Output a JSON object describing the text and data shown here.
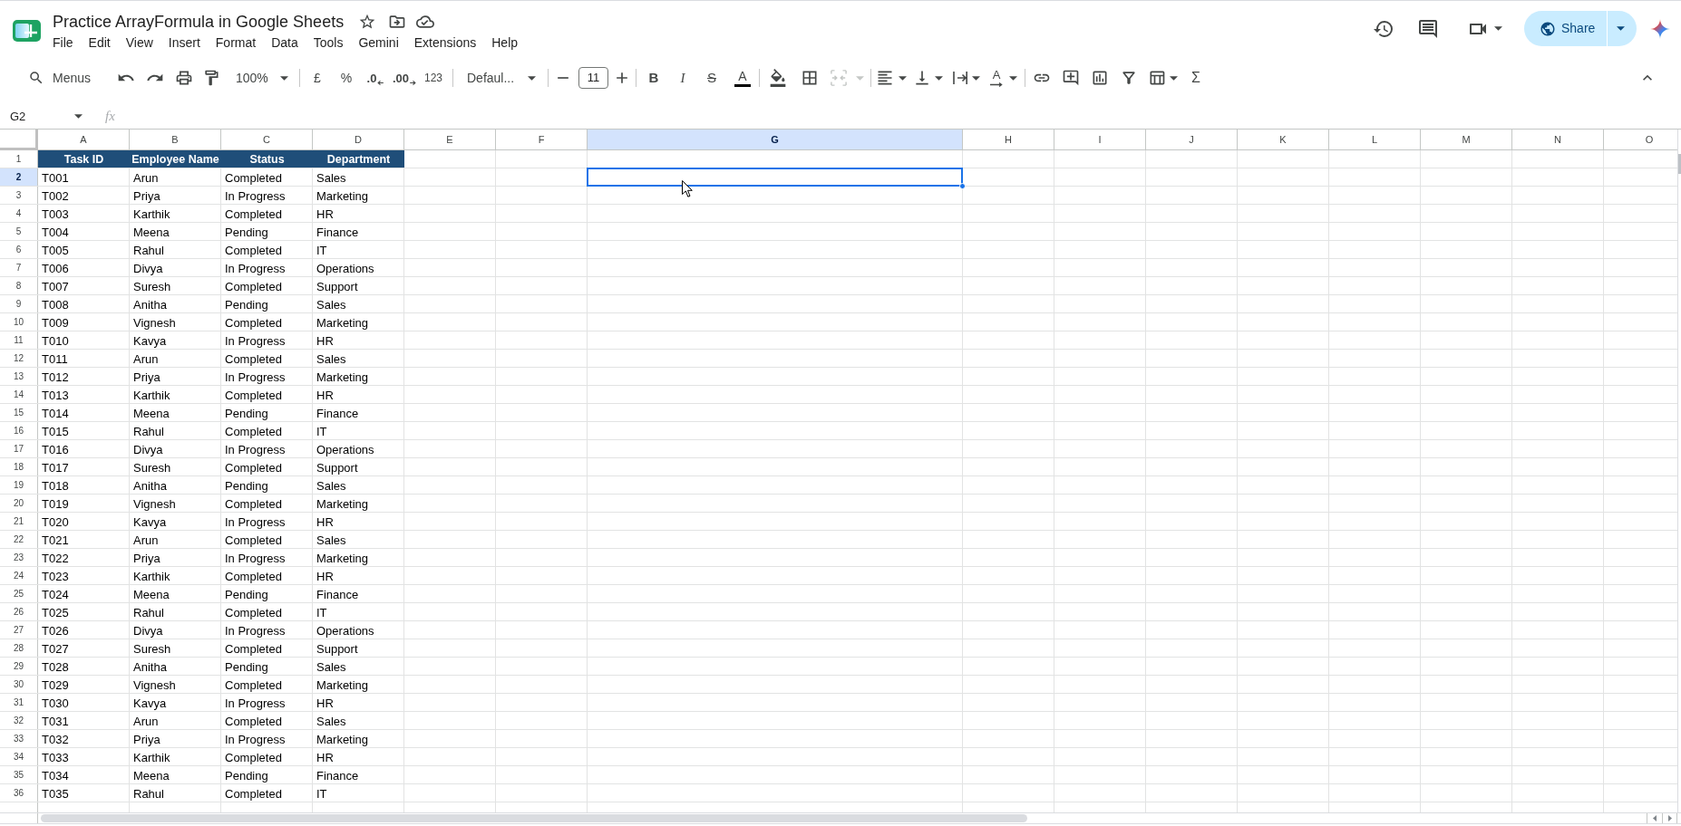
{
  "document": {
    "title": "Practice ArrayFormula in Google Sheets"
  },
  "menu": [
    "File",
    "Edit",
    "View",
    "Insert",
    "Format",
    "Data",
    "Tools",
    "Gemini",
    "Extensions",
    "Help"
  ],
  "share": {
    "label": "Share"
  },
  "toolbar": {
    "search": {
      "placeholder": "Menus"
    },
    "zoom": "100%",
    "currency": "£",
    "percent": "%",
    "decrease_decimals": ".0",
    "increase_decimals": ".00",
    "number_format": "123",
    "font": "Defaul...",
    "font_size": "11",
    "bold": "B",
    "italic": "I",
    "strikethrough": "S",
    "text_color": "A",
    "merge": {
      "disabled": true
    },
    "text_rotation": "A",
    "functions": "Σ"
  },
  "formula_bar": {
    "name_box": "G2",
    "fx": "fx"
  },
  "sheet": {
    "columns": [
      {
        "label": "A",
        "selected": false
      },
      {
        "label": "B",
        "selected": false
      },
      {
        "label": "C",
        "selected": false
      },
      {
        "label": "D",
        "selected": false
      },
      {
        "label": "E",
        "selected": false
      },
      {
        "label": "F",
        "selected": false
      },
      {
        "label": "G",
        "selected": true
      },
      {
        "label": "H",
        "selected": false
      },
      {
        "label": "I",
        "selected": false
      },
      {
        "label": "J",
        "selected": false
      },
      {
        "label": "K",
        "selected": false
      },
      {
        "label": "L",
        "selected": false
      },
      {
        "label": "M",
        "selected": false
      },
      {
        "label": "N",
        "selected": false
      },
      {
        "label": "O",
        "selected": false
      }
    ],
    "header_row": {
      "number": "1",
      "selected": false,
      "cells": [
        "Task ID",
        "Employee Name",
        "Status",
        "Department"
      ]
    },
    "rows": [
      {
        "number": "2",
        "selected": true,
        "cells": [
          "T001",
          "Arun",
          "Completed",
          "Sales"
        ]
      },
      {
        "number": "3",
        "selected": false,
        "cells": [
          "T002",
          "Priya",
          "In Progress",
          "Marketing"
        ]
      },
      {
        "number": "4",
        "selected": false,
        "cells": [
          "T003",
          "Karthik",
          "Completed",
          "HR"
        ]
      },
      {
        "number": "5",
        "selected": false,
        "cells": [
          "T004",
          "Meena",
          "Pending",
          "Finance"
        ]
      },
      {
        "number": "6",
        "selected": false,
        "cells": [
          "T005",
          "Rahul",
          "Completed",
          "IT"
        ]
      },
      {
        "number": "7",
        "selected": false,
        "cells": [
          "T006",
          "Divya",
          "In Progress",
          "Operations"
        ]
      },
      {
        "number": "8",
        "selected": false,
        "cells": [
          "T007",
          "Suresh",
          "Completed",
          "Support"
        ]
      },
      {
        "number": "9",
        "selected": false,
        "cells": [
          "T008",
          "Anitha",
          "Pending",
          "Sales"
        ]
      },
      {
        "number": "10",
        "selected": false,
        "cells": [
          "T009",
          "Vignesh",
          "Completed",
          "Marketing"
        ]
      },
      {
        "number": "11",
        "selected": false,
        "cells": [
          "T010",
          "Kavya",
          "In Progress",
          "HR"
        ]
      },
      {
        "number": "12",
        "selected": false,
        "cells": [
          "T011",
          "Arun",
          "Completed",
          "Sales"
        ]
      },
      {
        "number": "13",
        "selected": false,
        "cells": [
          "T012",
          "Priya",
          "In Progress",
          "Marketing"
        ]
      },
      {
        "number": "14",
        "selected": false,
        "cells": [
          "T013",
          "Karthik",
          "Completed",
          "HR"
        ]
      },
      {
        "number": "15",
        "selected": false,
        "cells": [
          "T014",
          "Meena",
          "Pending",
          "Finance"
        ]
      },
      {
        "number": "16",
        "selected": false,
        "cells": [
          "T015",
          "Rahul",
          "Completed",
          "IT"
        ]
      },
      {
        "number": "17",
        "selected": false,
        "cells": [
          "T016",
          "Divya",
          "In Progress",
          "Operations"
        ]
      },
      {
        "number": "18",
        "selected": false,
        "cells": [
          "T017",
          "Suresh",
          "Completed",
          "Support"
        ]
      },
      {
        "number": "19",
        "selected": false,
        "cells": [
          "T018",
          "Anitha",
          "Pending",
          "Sales"
        ]
      },
      {
        "number": "20",
        "selected": false,
        "cells": [
          "T019",
          "Vignesh",
          "Completed",
          "Marketing"
        ]
      },
      {
        "number": "21",
        "selected": false,
        "cells": [
          "T020",
          "Kavya",
          "In Progress",
          "HR"
        ]
      },
      {
        "number": "22",
        "selected": false,
        "cells": [
          "T021",
          "Arun",
          "Completed",
          "Sales"
        ]
      },
      {
        "number": "23",
        "selected": false,
        "cells": [
          "T022",
          "Priya",
          "In Progress",
          "Marketing"
        ]
      },
      {
        "number": "24",
        "selected": false,
        "cells": [
          "T023",
          "Karthik",
          "Completed",
          "HR"
        ]
      },
      {
        "number": "25",
        "selected": false,
        "cells": [
          "T024",
          "Meena",
          "Pending",
          "Finance"
        ]
      },
      {
        "number": "26",
        "selected": false,
        "cells": [
          "T025",
          "Rahul",
          "Completed",
          "IT"
        ]
      },
      {
        "number": "27",
        "selected": false,
        "cells": [
          "T026",
          "Divya",
          "In Progress",
          "Operations"
        ]
      },
      {
        "number": "28",
        "selected": false,
        "cells": [
          "T027",
          "Suresh",
          "Completed",
          "Support"
        ]
      },
      {
        "number": "29",
        "selected": false,
        "cells": [
          "T028",
          "Anitha",
          "Pending",
          "Sales"
        ]
      },
      {
        "number": "30",
        "selected": false,
        "cells": [
          "T029",
          "Vignesh",
          "Completed",
          "Marketing"
        ]
      },
      {
        "number": "31",
        "selected": false,
        "cells": [
          "T030",
          "Kavya",
          "In Progress",
          "HR"
        ]
      },
      {
        "number": "32",
        "selected": false,
        "cells": [
          "T031",
          "Arun",
          "Completed",
          "Sales"
        ]
      },
      {
        "number": "33",
        "selected": false,
        "cells": [
          "T032",
          "Priya",
          "In Progress",
          "Marketing"
        ]
      },
      {
        "number": "34",
        "selected": false,
        "cells": [
          "T033",
          "Karthik",
          "Completed",
          "HR"
        ]
      },
      {
        "number": "35",
        "selected": false,
        "cells": [
          "T034",
          "Meena",
          "Pending",
          "Finance"
        ]
      },
      {
        "number": "36",
        "selected": false,
        "cells": [
          "T035",
          "Rahul",
          "Completed",
          "IT"
        ]
      }
    ]
  }
}
